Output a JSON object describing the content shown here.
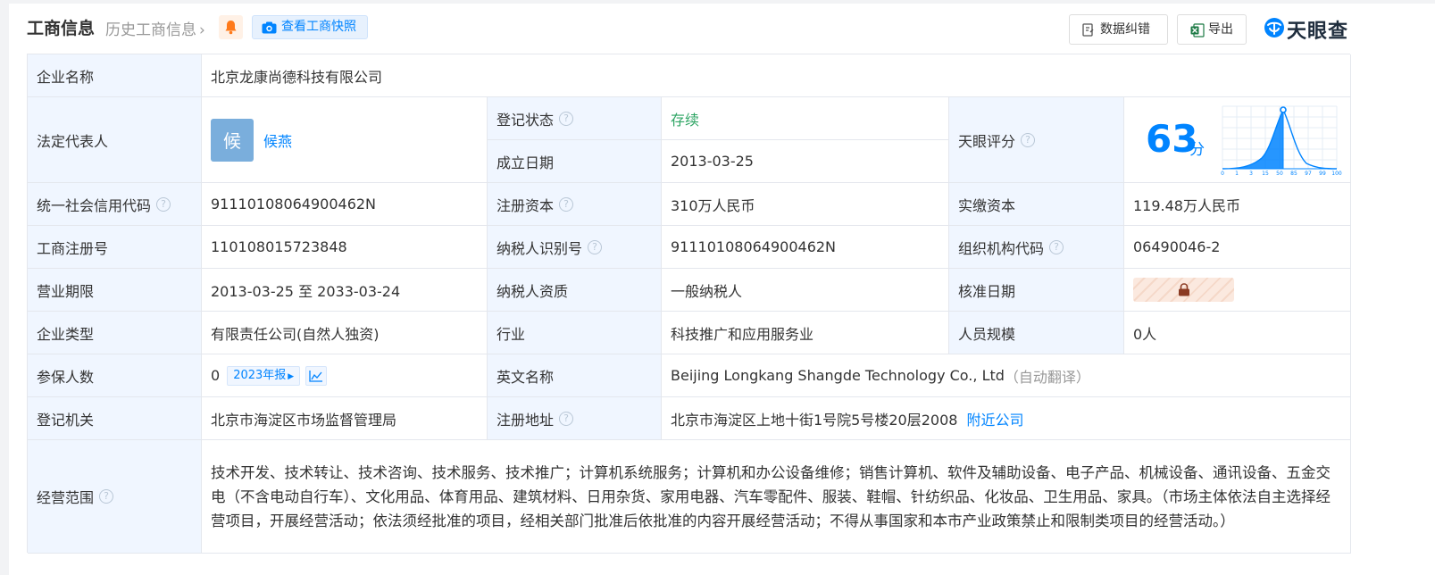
{
  "header": {
    "title": "工商信息",
    "history": "历史工商信息",
    "snapshot": "查看工商快照",
    "data_fix": "数据纠错",
    "export": "导出",
    "brand": "天眼查"
  },
  "colors": {
    "accent": "#0084ff",
    "label_bg": "#f0f6ff",
    "status_green": "#2fa564"
  },
  "rows": {
    "company_name": {
      "label": "企业名称",
      "value": "北京龙康尚德科技有限公司"
    },
    "legal_rep": {
      "label": "法定代表人",
      "avatar_char": "候",
      "name": "候燕"
    },
    "reg_status": {
      "label": "登记状态",
      "value": "存续"
    },
    "found_date": {
      "label": "成立日期",
      "value": "2013-03-25"
    },
    "rating": {
      "label": "天眼评分",
      "score": "63",
      "unit": "分",
      "axis": [
        "0",
        "1",
        "3",
        "15",
        "50",
        "85",
        "97",
        "99",
        "100"
      ]
    },
    "credit_code": {
      "label": "统一社会信用代码",
      "value": "91110108064900462N"
    },
    "reg_capital": {
      "label": "注册资本",
      "value": "310万人民币"
    },
    "paid_capital": {
      "label": "实缴资本",
      "value": "119.48万人民币"
    },
    "reg_no": {
      "label": "工商注册号",
      "value": "110108015723848"
    },
    "taxpayer_id": {
      "label": "纳税人识别号",
      "value": "91110108064900462N"
    },
    "org_code": {
      "label": "组织机构代码",
      "value": "06490046-2"
    },
    "biz_term": {
      "label": "营业期限",
      "value": "2013-03-25 至 2033-03-24"
    },
    "tax_qual": {
      "label": "纳税人资质",
      "value": "一般纳税人"
    },
    "approve_date": {
      "label": "核准日期"
    },
    "ent_type": {
      "label": "企业类型",
      "value": "有限责任公司(自然人独资)"
    },
    "industry": {
      "label": "行业",
      "value": "科技推广和应用服务业"
    },
    "staff": {
      "label": "人员规模",
      "value": "0人"
    },
    "insured": {
      "label": "参保人数",
      "value": "0",
      "report": "2023年报"
    },
    "en_name": {
      "label": "英文名称",
      "value": "Beijing Longkang Shangde Technology Co., Ltd",
      "note": "（自动翻译）"
    },
    "reg_authority": {
      "label": "登记机关",
      "value": "北京市海淀区市场监督管理局"
    },
    "reg_address": {
      "label": "注册地址",
      "value": "北京市海淀区上地十街1号院5号楼20层2008",
      "nearby": "附近公司"
    },
    "scope": {
      "label": "经营范围",
      "value": "技术开发、技术转让、技术咨询、技术服务、技术推广；计算机系统服务；计算机和办公设备维修；销售计算机、软件及辅助设备、电子产品、机械设备、通讯设备、五金交电（不含电动自行车）、文化用品、体育用品、建筑材料、日用杂货、家用电器、汽车零配件、服装、鞋帽、针纺织品、化妆品、卫生用品、家具。（市场主体依法自主选择经营项目，开展经营活动；依法须经批准的项目，经相关部门批准后依批准的内容开展经营活动；不得从事国家和本市产业政策禁止和限制类项目的经营活动。）"
    }
  }
}
